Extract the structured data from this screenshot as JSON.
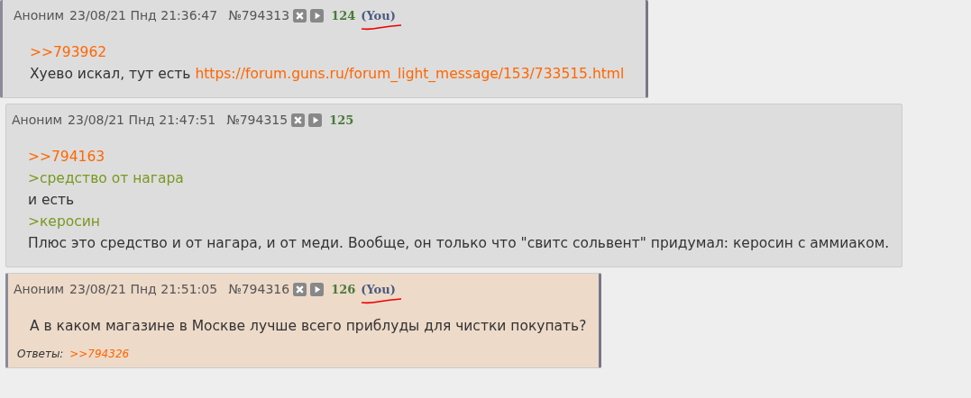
{
  "posts": [
    {
      "name": "Аноним",
      "date": "23/08/21 Пнд 21:36:47",
      "number": "№794313",
      "index": "124",
      "you": "(You)",
      "own": true,
      "highlighted": false,
      "lines": [
        {
          "kind": "reply",
          "text": ">>793962"
        },
        {
          "kind": "text",
          "text": "Хуево искал, тут есть ",
          "link": "https://forum.guns.ru/forum_light_message/153/733515.html"
        }
      ]
    },
    {
      "name": "Аноним",
      "date": "23/08/21 Пнд 21:47:51",
      "number": "№794315",
      "index": "125",
      "own": false,
      "highlighted": false,
      "lines": [
        {
          "kind": "reply",
          "text": ">>794163"
        },
        {
          "kind": "quote",
          "text": ">средство от нагара"
        },
        {
          "kind": "text",
          "text": "и есть"
        },
        {
          "kind": "quote",
          "text": ">керосин"
        },
        {
          "kind": "text",
          "text": "Плюс это средство и от нагара, и от меди. Вообще, он только что \"свитс сольвент\" придумал: керосин с аммиаком."
        }
      ]
    },
    {
      "name": "Аноним",
      "date": "23/08/21 Пнд 21:51:05",
      "number": "№794316",
      "index": "126",
      "you": "(You)",
      "own": true,
      "highlighted": true,
      "lines": [
        {
          "kind": "text",
          "text": "А в каком магазине в Москве лучше всего приблуды для чистки покупать?"
        }
      ],
      "replies": {
        "label": "Ответы:",
        "links": [
          ">>794326"
        ]
      }
    }
  ]
}
